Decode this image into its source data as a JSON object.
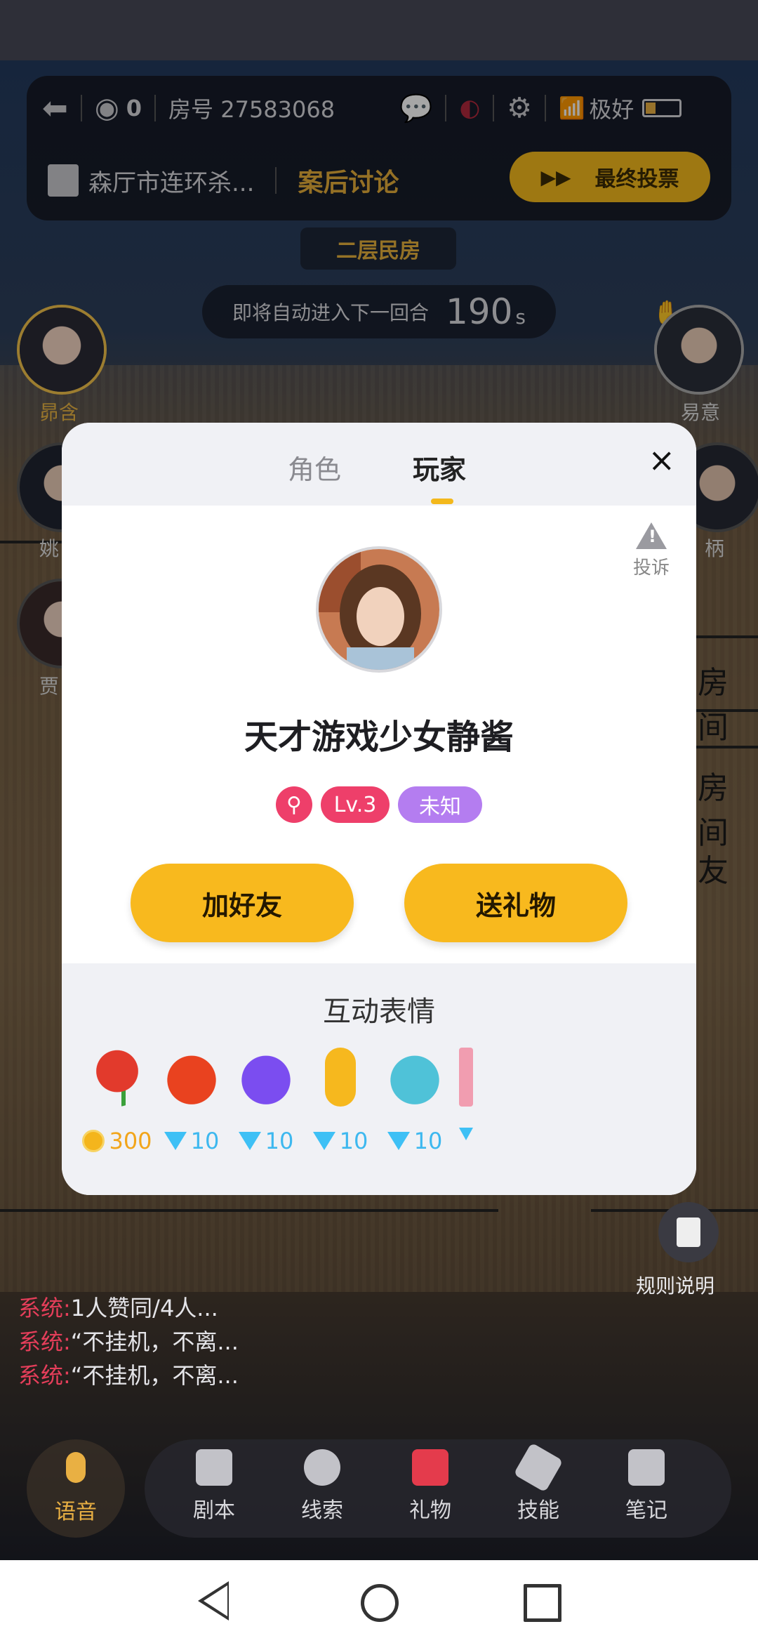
{
  "topbar": {
    "viewer_count": "0",
    "room_label": "房号 27583068",
    "signal_text": "极好",
    "script_title": "森厅市连环杀...",
    "phase_text": "案后讨论",
    "vote_button": "最终投票"
  },
  "stage": {
    "location": "二层民房",
    "countdown_text": "即将自动进入下一回合",
    "countdown_number": "190",
    "countdown_unit": "s"
  },
  "players": {
    "left": [
      "昴含",
      "姚",
      "贾"
    ],
    "right": [
      "易意",
      "柄"
    ]
  },
  "background_text": [
    "房间",
    "房间",
    "友"
  ],
  "modal": {
    "tabs": [
      "角色",
      "玩家"
    ],
    "active_tab": "玩家",
    "close": "×",
    "report_label": "投诉",
    "nickname": "天才游戏少女静酱",
    "badges": {
      "level": "Lv.3",
      "tag": "未知"
    },
    "add_friend": "加好友",
    "send_gift": "送礼物",
    "emote_title": "互动表情",
    "emotes": [
      {
        "name": "rose",
        "price": "300",
        "currency": "coin"
      },
      {
        "name": "tomato",
        "price": "10",
        "currency": "diamond"
      },
      {
        "name": "purple-blob",
        "price": "10",
        "currency": "diamond"
      },
      {
        "name": "yellow-creature",
        "price": "10",
        "currency": "diamond"
      },
      {
        "name": "balloon",
        "price": "10",
        "currency": "diamond"
      }
    ]
  },
  "rules": {
    "label": "规则说明"
  },
  "chat": [
    {
      "sender": "系统:",
      "text": "1人赞同/4人..."
    },
    {
      "sender": "系统:",
      "text": "“不挂机，不离..."
    },
    {
      "sender": "系统:",
      "text": "“不挂机，不离..."
    }
  ],
  "bottom": {
    "voice": "语音",
    "tools": [
      "剧本",
      "线索",
      "礼物",
      "技能",
      "笔记"
    ]
  },
  "colors": {
    "accent": "#f8b91e",
    "level_badge": "#ee3f6a",
    "tag_badge": "#b47df0"
  }
}
